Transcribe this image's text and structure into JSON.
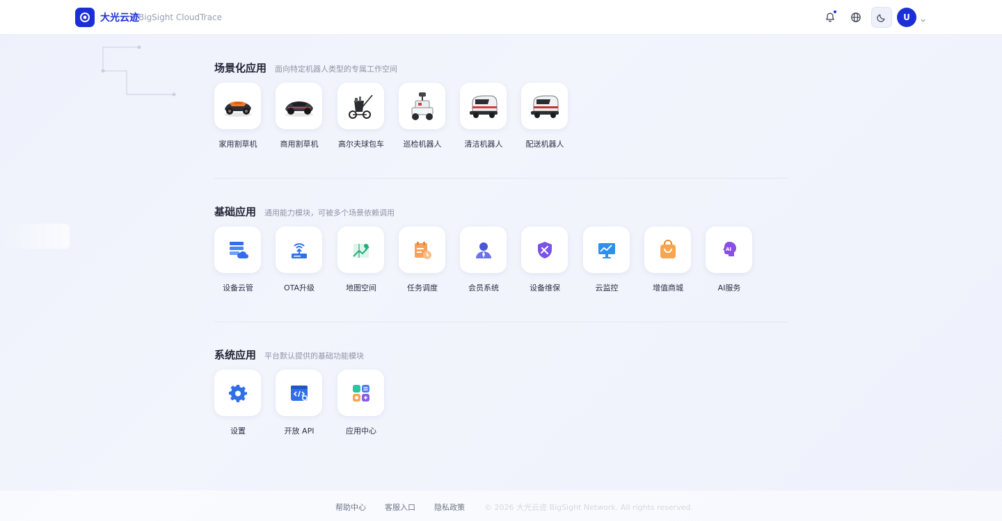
{
  "header": {
    "brand_name": "大光云迹",
    "brand_sub": "BigSight CloudTrace",
    "avatar_letter": "U",
    "accent_color": "#1b2fd6",
    "icons": [
      "bell-icon",
      "globe-icon",
      "moon-icon",
      "chevron-down-icon"
    ]
  },
  "sections": [
    {
      "title": "场景化应用",
      "desc": "面向特定机器人类型的专属工作空间",
      "apps": [
        {
          "label": "家用割草机",
          "icon": "home-mower-icon"
        },
        {
          "label": "商用割草机",
          "icon": "commercial-mower-icon"
        },
        {
          "label": "高尔夫球包车",
          "icon": "golf-caddy-icon"
        },
        {
          "label": "巡检机器人",
          "icon": "patrol-robot-icon"
        },
        {
          "label": "清洁机器人",
          "icon": "cleaning-robot-icon"
        },
        {
          "label": "配送机器人",
          "icon": "delivery-robot-icon"
        }
      ]
    },
    {
      "title": "基础应用",
      "desc": "通用能力模块，可被多个场景依赖调用",
      "apps": [
        {
          "label": "设备云管",
          "icon": "device-cloud-icon"
        },
        {
          "label": "OTA升级",
          "icon": "ota-upgrade-icon"
        },
        {
          "label": "地图空间",
          "icon": "map-icon"
        },
        {
          "label": "任务调度",
          "icon": "task-schedule-icon"
        },
        {
          "label": "会员系统",
          "icon": "member-icon"
        },
        {
          "label": "设备维保",
          "icon": "maintenance-icon"
        },
        {
          "label": "云监控",
          "icon": "monitor-icon"
        },
        {
          "label": "增值商城",
          "icon": "shop-icon"
        },
        {
          "label": "AI服务",
          "icon": "ai-icon"
        }
      ]
    },
    {
      "title": "系统应用",
      "desc": "平台默认提供的基础功能模块",
      "apps": [
        {
          "label": "设置",
          "icon": "gear-icon"
        },
        {
          "label": "开放 API",
          "icon": "api-icon"
        },
        {
          "label": "应用中心",
          "icon": "app-center-icon"
        }
      ]
    }
  ],
  "footer": {
    "links": [
      "帮助中心",
      "客服入口",
      "隐私政策"
    ],
    "copyright": "© 2026 大光云迹 BigSight Network. All rights reserved."
  }
}
